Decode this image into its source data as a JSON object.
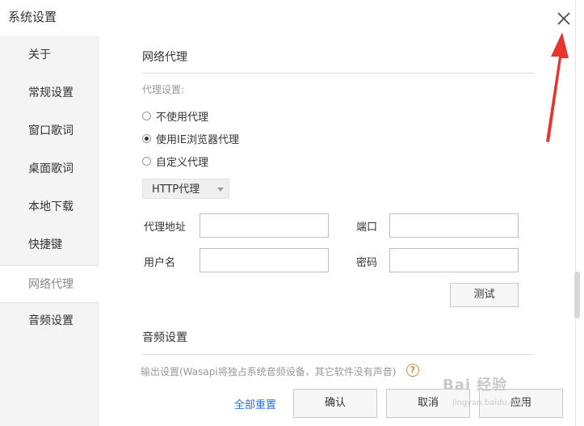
{
  "window": {
    "title": "系统设置"
  },
  "sidebar": {
    "items": [
      {
        "label": "关于"
      },
      {
        "label": "常规设置"
      },
      {
        "label": "窗口歌词"
      },
      {
        "label": "桌面歌词"
      },
      {
        "label": "本地下载"
      },
      {
        "label": "快捷键"
      },
      {
        "label": "网络代理",
        "active": true
      },
      {
        "label": "音频设置"
      }
    ]
  },
  "proxy": {
    "section_title": "网络代理",
    "settings_hint": "代理设置:",
    "options": [
      {
        "label": "不使用代理",
        "checked": false
      },
      {
        "label": "使用IE浏览器代理",
        "checked": true
      },
      {
        "label": "自定义代理",
        "checked": false
      }
    ],
    "type_select": "HTTP代理",
    "address_label": "代理地址",
    "address_value": "",
    "port_label": "端口",
    "port_value": "",
    "username_label": "用户名",
    "username_value": "",
    "password_label": "密码",
    "password_value": "",
    "test_button": "测试"
  },
  "audio": {
    "section_title": "音频设置",
    "output_hint": "输出设置(Wasapi将独占系统音频设备，其它软件没有声音)",
    "help_icon": "?"
  },
  "footer": {
    "reset_link": "全部重置",
    "confirm_button": "确认",
    "cancel_button": "取消",
    "apply_button": "应用"
  },
  "annotation": {
    "arrow_color": "#e8342f"
  },
  "watermark": {
    "text": "Bai 经验",
    "sub": "jingyan.baidu.com"
  }
}
